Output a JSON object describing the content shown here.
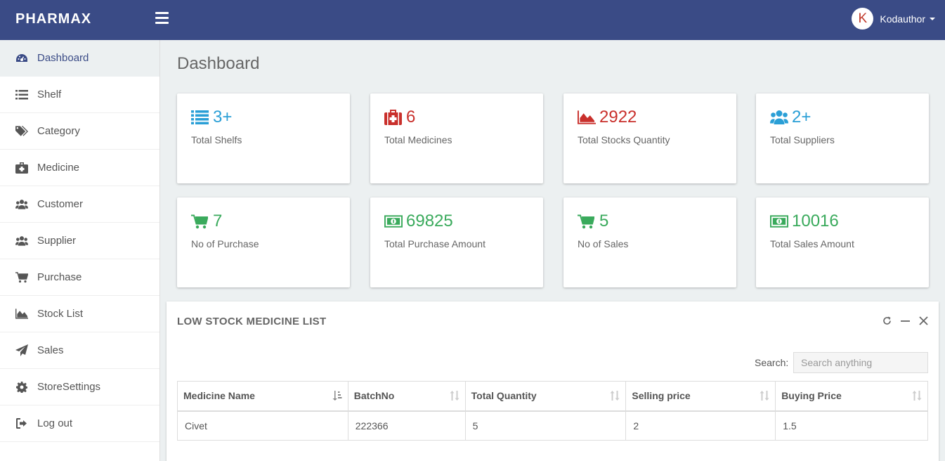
{
  "header": {
    "brand": "PHARMAX",
    "user_initial": "K",
    "username": "Kodauthor"
  },
  "sidebar": {
    "items": [
      {
        "label": "Dashboard",
        "icon": "dashboard-icon",
        "active": true
      },
      {
        "label": "Shelf",
        "icon": "list-icon"
      },
      {
        "label": "Category",
        "icon": "tags-icon"
      },
      {
        "label": "Medicine",
        "icon": "medkit-icon"
      },
      {
        "label": "Customer",
        "icon": "users-icon"
      },
      {
        "label": "Supplier",
        "icon": "users-icon"
      },
      {
        "label": "Purchase",
        "icon": "cart-icon"
      },
      {
        "label": "Stock List",
        "icon": "area-chart-icon"
      },
      {
        "label": "Sales",
        "icon": "paper-plane-icon"
      },
      {
        "label": "StoreSettings",
        "icon": "gear-icon"
      },
      {
        "label": "Log out",
        "icon": "sign-out-icon"
      }
    ]
  },
  "main": {
    "title": "Dashboard",
    "cards": [
      {
        "value": "3+",
        "label": "Total Shelfs",
        "icon": "list-icon",
        "color": "#2a9fd6"
      },
      {
        "value": "6",
        "label": "Total Medicines",
        "icon": "medkit-icon",
        "color": "#c9302c"
      },
      {
        "value": "2922",
        "label": "Total Stocks Quantity",
        "icon": "area-chart-icon",
        "color": "#c9302c"
      },
      {
        "value": "2+",
        "label": "Total Suppliers",
        "icon": "users-icon",
        "color": "#2a9fd6"
      },
      {
        "value": "7",
        "label": "No of Purchase",
        "icon": "cart-icon",
        "color": "#3aaa5c"
      },
      {
        "value": "69825",
        "label": "Total Purchase Amount",
        "icon": "money-icon",
        "color": "#3aaa5c"
      },
      {
        "value": "5",
        "label": "No of Sales",
        "icon": "cart-icon",
        "color": "#3aaa5c"
      },
      {
        "value": "10016",
        "label": "Total Sales Amount",
        "icon": "money-icon",
        "color": "#3aaa5c"
      }
    ]
  },
  "panel": {
    "title": "LOW STOCK MEDICINE LIST",
    "search_label": "Search:",
    "search_placeholder": "Search anything",
    "columns": [
      "Medicine Name",
      "BatchNo",
      "Total Quantity",
      "Selling price",
      "Buying Price"
    ],
    "rows": [
      [
        "Civet",
        "222366",
        "5",
        "2",
        "1.5"
      ]
    ]
  }
}
